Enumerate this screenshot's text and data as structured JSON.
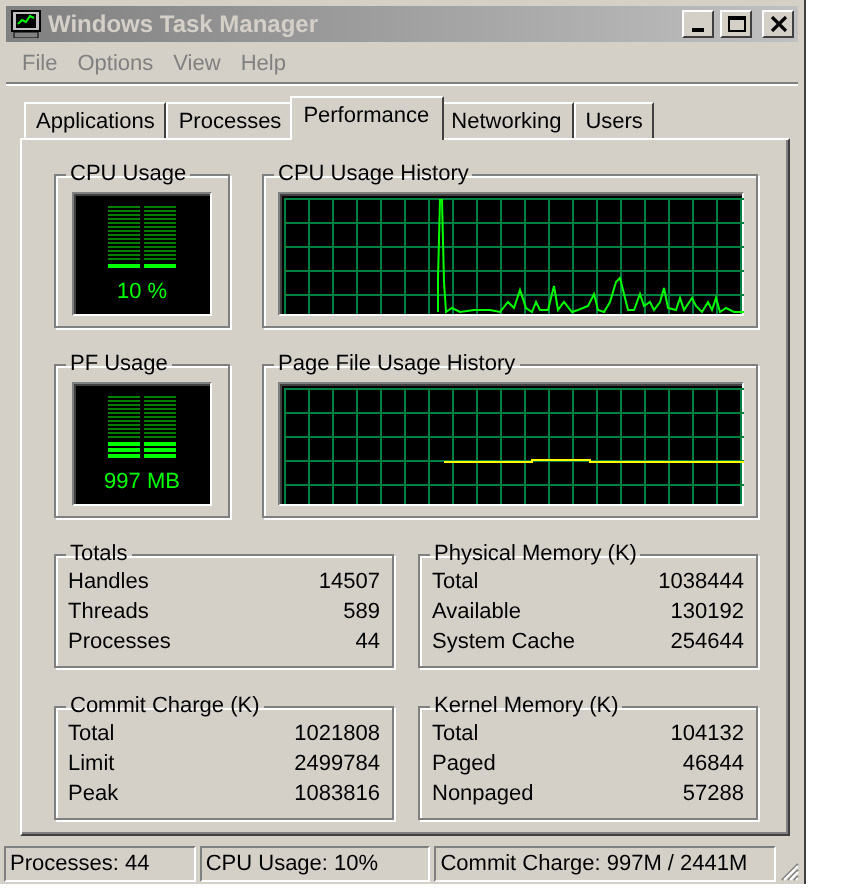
{
  "window": {
    "title": "Windows Task Manager"
  },
  "menu": [
    "File",
    "Options",
    "View",
    "Help"
  ],
  "tabs": [
    {
      "label": "Applications",
      "selected": false
    },
    {
      "label": "Processes",
      "selected": false
    },
    {
      "label": "Performance",
      "selected": true
    },
    {
      "label": "Networking",
      "selected": false
    },
    {
      "label": "Users",
      "selected": false
    }
  ],
  "cpu_usage": {
    "title": "CPU Usage",
    "reading": "10 %"
  },
  "cpu_usage_history": {
    "title": "CPU Usage History"
  },
  "pf_usage": {
    "title": "PF Usage",
    "reading": "997 MB"
  },
  "page_file_usage_history": {
    "title": "Page File Usage History"
  },
  "stat_groups": [
    {
      "title": "Totals",
      "rows": [
        {
          "label": "Handles",
          "value": "14507"
        },
        {
          "label": "Threads",
          "value": "589"
        },
        {
          "label": "Processes",
          "value": "44"
        }
      ]
    },
    {
      "title": "Physical Memory (K)",
      "rows": [
        {
          "label": "Total",
          "value": "1038444"
        },
        {
          "label": "Available",
          "value": "130192"
        },
        {
          "label": "System Cache",
          "value": "254644"
        }
      ]
    },
    {
      "title": "Commit Charge (K)",
      "rows": [
        {
          "label": "Total",
          "value": "1021808"
        },
        {
          "label": "Limit",
          "value": "2499784"
        },
        {
          "label": "Peak",
          "value": "1083816"
        }
      ]
    },
    {
      "title": "Kernel Memory (K)",
      "rows": [
        {
          "label": "Total",
          "value": "104132"
        },
        {
          "label": "Paged",
          "value": "46844"
        },
        {
          "label": "Nonpaged",
          "value": "57288"
        }
      ]
    }
  ],
  "status_bar": [
    "Processes: 44",
    "CPU Usage: 10%",
    "Commit Charge: 997M / 2441M"
  ]
}
